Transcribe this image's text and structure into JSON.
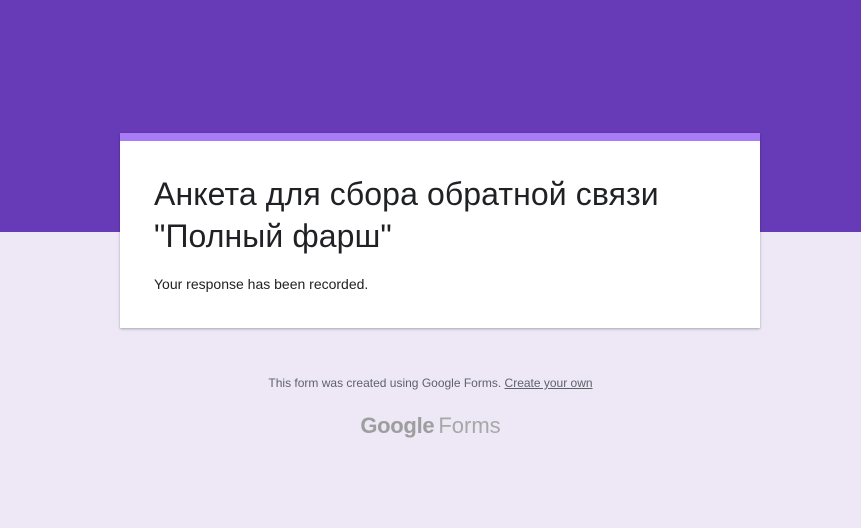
{
  "colors": {
    "header_band": "#673ab7",
    "card_accent": "#a87cf5",
    "page_background": "#ede7f6"
  },
  "form": {
    "title": "Анкета для сбора обратной связи \"Полный фарш\"",
    "confirmation_message": "Your response has been recorded."
  },
  "footer": {
    "note": "This form was created using Google Forms.",
    "link_label": "Create your own"
  },
  "brand": {
    "google": "Google",
    "forms": "Forms"
  }
}
